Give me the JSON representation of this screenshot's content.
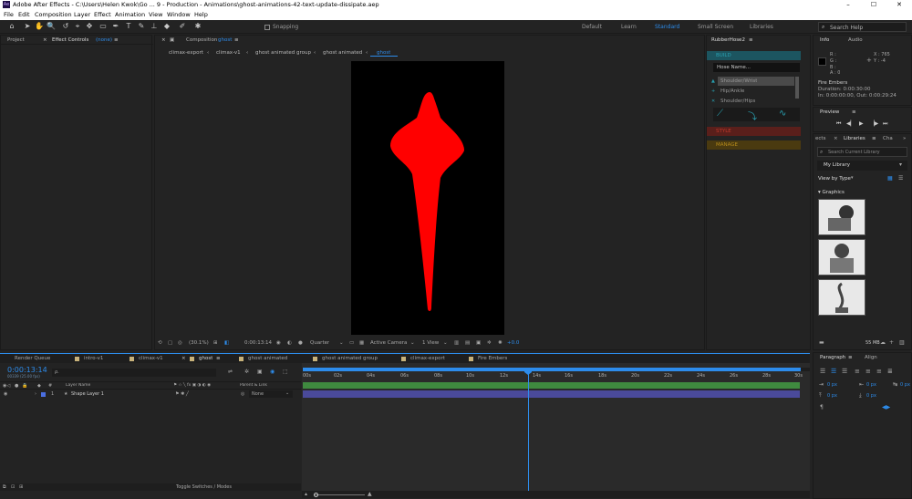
{
  "window": {
    "title": "Adobe After Effects - C:\\Users\\Helen Kwok\\Go ... 9 - Production - Animations\\ghost-animations-42-text-update-dissipate.aep",
    "logo": "Ae",
    "minimize": "–",
    "maximize": "☐",
    "close": "✕"
  },
  "menu": [
    "File",
    "Edit",
    "Composition",
    "Layer",
    "Effect",
    "Animation",
    "View",
    "Window",
    "Help"
  ],
  "toolbar": {
    "snapping_label": "Snapping",
    "workspaces": [
      "Default",
      "Learn",
      "Standard",
      "Small Screen",
      "Libraries"
    ],
    "active_workspace": "Standard",
    "search_placeholder": "Search Help"
  },
  "left_panel": {
    "tab_project": "Project",
    "tab_effect_controls": "Effect Controls",
    "effect_controls_value": "(none)"
  },
  "composition": {
    "tab_label": "Composition",
    "tab_name": "ghost",
    "breadcrumbs": [
      "climax-export",
      "climax-v1",
      "ghost animated group",
      "ghost animated",
      "ghost"
    ],
    "active_crumb": "ghost",
    "zoom": "(30.1%)",
    "timecode": "0:00:13:14",
    "resolution": "Quarter",
    "camera": "Active Camera",
    "views": "1 View",
    "exposure": "+0.0",
    "shape_color": "#ff0000"
  },
  "rubberhose": {
    "title": "RubberHose2",
    "build": "BUILD",
    "hose_name_placeholder": "Hose Name...",
    "list": [
      "Shoulder/Wrist",
      "Hip/Ankle",
      "Shoulder/Hips"
    ],
    "style": "STYLE",
    "manage": "MANAGE",
    "build_color": "#29a0b0",
    "style_color": "#c0392b",
    "manage_color": "#b58a1a"
  },
  "info": {
    "tab_info": "Info",
    "tab_audio": "Audio",
    "r": "R :",
    "g": "G :",
    "b": "B :",
    "a": "A :  0",
    "x": "X : 765",
    "y": "Y : -4",
    "layer_name": "Fire Embers",
    "duration": "Duration: 0:00:30:00",
    "in_out": "In: 0:00:00:00, Out: 0:00:29:24"
  },
  "preview": {
    "title": "Preview"
  },
  "libraries": {
    "tab_effects": "ects",
    "tab_libraries": "Libraries",
    "tab_character": "Cha",
    "search_placeholder": "Search Current Library",
    "library": "My Library",
    "view_by": "View by Type",
    "section": "Graphics",
    "size": "55 MB"
  },
  "paragraph": {
    "tab_paragraph": "Paragraph",
    "tab_align": "Align",
    "px_values": [
      "0 px",
      "0 px",
      "0 px",
      "0 px",
      "0 px"
    ]
  },
  "timeline": {
    "tabs": [
      {
        "label": "Render Queue",
        "color": ""
      },
      {
        "label": "intro-v1",
        "color": "#c8b27a"
      },
      {
        "label": "climax-v1",
        "color": "#c8b27a"
      },
      {
        "label": "ghost",
        "color": "#c8b27a"
      },
      {
        "label": "ghost animated",
        "color": "#c8b27a"
      },
      {
        "label": "ghost animated group",
        "color": "#c8b27a"
      },
      {
        "label": "climax-export",
        "color": "#c8b27a"
      },
      {
        "label": "Fire Embers",
        "color": "#c8b27a"
      }
    ],
    "active_tab": "ghost",
    "timecode": "0:00:13:14",
    "frame_info": "00339 (25.00 fps)",
    "search_placeholder": "ρ.",
    "col_layer_name": "Layer Name",
    "col_parent": "Parent & Link",
    "layer": {
      "number": "1",
      "name": "Shape Layer 1",
      "parent": "None",
      "label_color": "#4a6ee0"
    },
    "ruler": [
      "00s",
      "02s",
      "04s",
      "06s",
      "08s",
      "10s",
      "12s",
      "14s",
      "16s",
      "18s",
      "20s",
      "22s",
      "24s",
      "26s",
      "28s",
      "30s"
    ],
    "toggle_label": "Toggle Switches / Modes"
  }
}
